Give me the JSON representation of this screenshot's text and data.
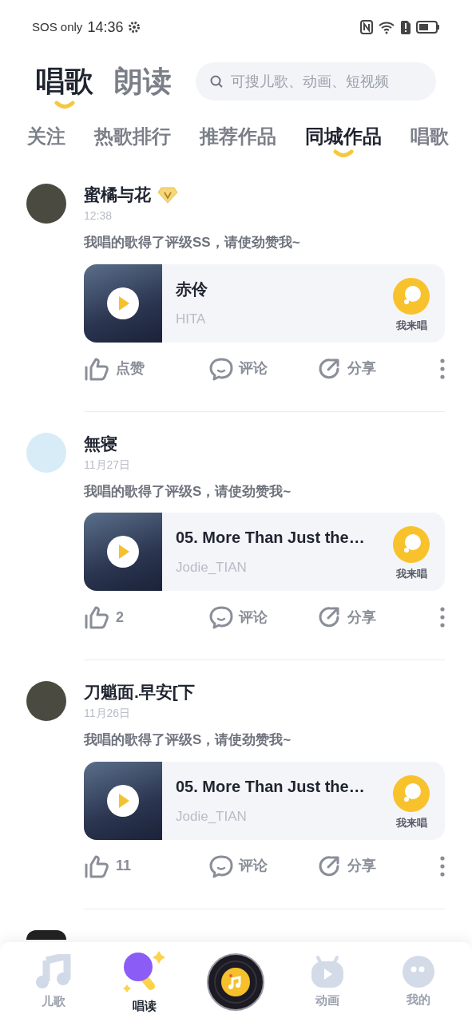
{
  "status_bar": {
    "carrier": "SOS only",
    "time": "14:36"
  },
  "header": {
    "tabs": [
      {
        "label": "唱歌",
        "selected": true
      },
      {
        "label": "朗读",
        "selected": false
      }
    ],
    "search": {
      "placeholder": "可搜儿歌、动画、短视频"
    }
  },
  "categories": [
    {
      "label": "关注",
      "selected": false
    },
    {
      "label": "热歌排行",
      "selected": false
    },
    {
      "label": "推荐作品",
      "selected": false
    },
    {
      "label": "同城作品",
      "selected": true
    },
    {
      "label": "唱歌",
      "selected": false
    }
  ],
  "posts": [
    {
      "user": "蜜橘与花",
      "vip": true,
      "time": "12:38",
      "message": "我唱的歌得了评级SS，请使劲赞我~",
      "song": {
        "title": "赤伶",
        "artist": "HITA"
      },
      "sing_label": "我来唱",
      "like": "点赞",
      "comment": "评论",
      "share": "分享"
    },
    {
      "user": "無寝",
      "vip": false,
      "time": "11月27日",
      "message": "我唱的歌得了评级S，请使劲赞我~",
      "song": {
        "title": "05. More Than Just the…",
        "artist": "Jodie_TIAN"
      },
      "sing_label": "我来唱",
      "like": "2",
      "comment": "评论",
      "share": "分享"
    },
    {
      "user": "刀魈面.早安[下",
      "vip": false,
      "time": "11月26日",
      "message": "我唱的歌得了评级S，请使劲赞我~",
      "song": {
        "title": "05. More Than Just the…",
        "artist": "Jodie_TIAN"
      },
      "sing_label": "我来唱",
      "like": "11",
      "comment": "评论",
      "share": "分享"
    }
  ],
  "bottom_nav": [
    {
      "label": "儿歌",
      "kind": "note",
      "selected": false
    },
    {
      "label": "唱读",
      "kind": "mic",
      "selected": true
    },
    {
      "kind": "record"
    },
    {
      "label": "动画",
      "kind": "tv",
      "selected": false
    },
    {
      "label": "我的",
      "kind": "face",
      "selected": false
    }
  ]
}
